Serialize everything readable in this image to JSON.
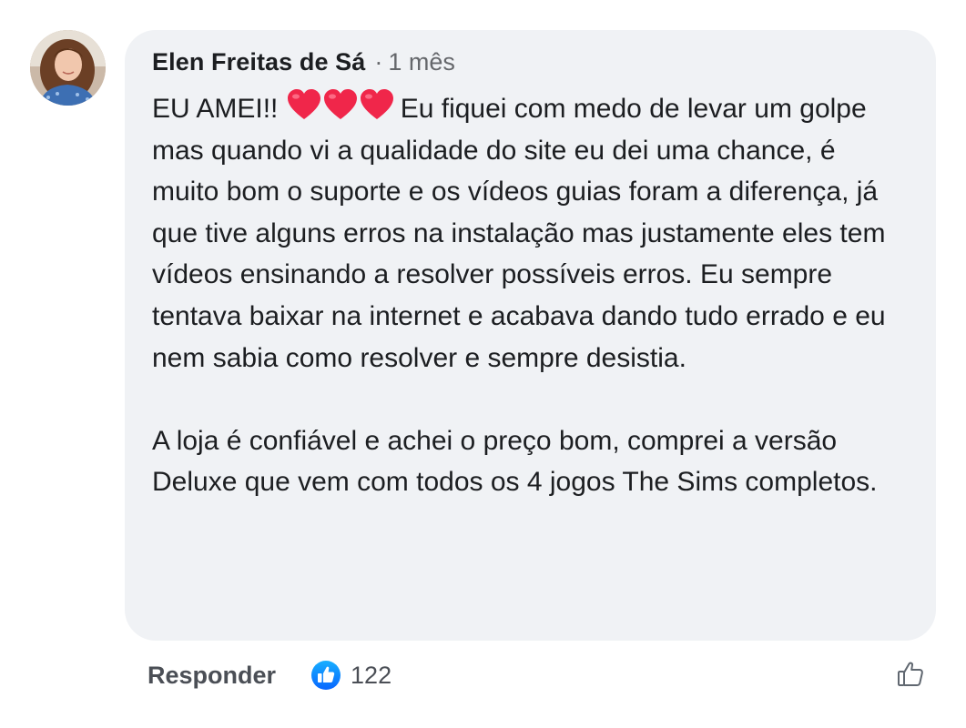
{
  "comment": {
    "author": "Elen Freitas de Sá",
    "separator": "·",
    "time": "1 mês",
    "text_start": "EU AMEI!!",
    "emoji_icons": [
      "red-heart-icon",
      "red-heart-icon",
      "red-heart-icon"
    ],
    "text_rest": "Eu fiquei com medo de levar um golpe mas quando vi a qualidade do site eu dei uma chance, é muito bom o suporte e os vídeos guias foram a diferença, já que tive alguns erros na instalação mas justamente eles tem vídeos ensinando a resolver possíveis erros. Eu sempre tentava baixar na internet e acabava dando tudo errado e eu nem sabia como resolver e sempre desistia.",
    "paragraph_2": "A loja é confiável e achei o preço bom, comprei a versão Deluxe que vem com todos os 4 jogos The Sims completos."
  },
  "footer": {
    "reply_label": "Responder",
    "like_count": "122",
    "reaction_icon": "like-badge-icon",
    "like_button_icon": "thumbs-up-outline-icon"
  },
  "colors": {
    "bubble_bg": "#f0f2f5",
    "text": "#1c1e21",
    "muted": "#65676b",
    "like_blue": "#1877f2",
    "heart_red": "#f0264a"
  }
}
